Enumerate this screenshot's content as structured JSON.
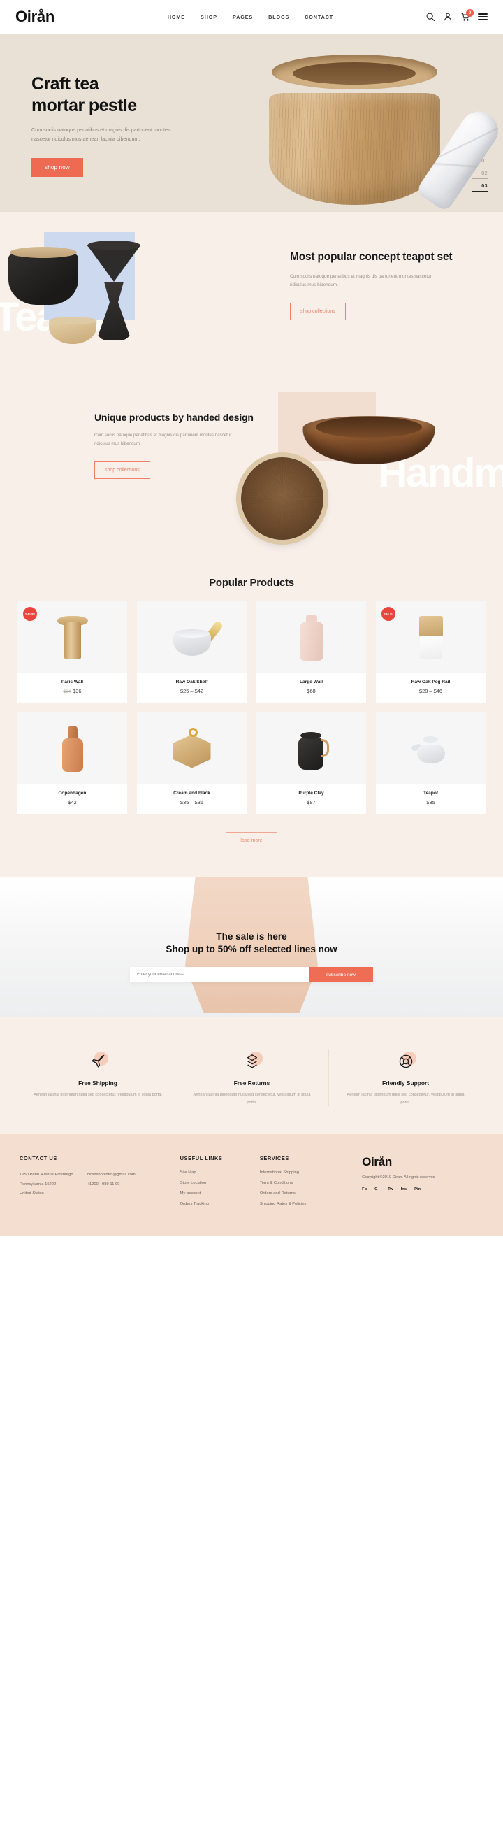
{
  "header": {
    "logo": "Oirån",
    "nav": [
      {
        "label": "HOME"
      },
      {
        "label": "SHOP"
      },
      {
        "label": "PAGES"
      },
      {
        "label": "BLOGS"
      },
      {
        "label": "CONTACT"
      }
    ],
    "icons": {
      "search": "search-icon",
      "account": "user-icon",
      "cart": "cart-icon",
      "menu": "hamburger-icon"
    },
    "cart_count": "0"
  },
  "hero": {
    "title_line1": "Craft tea",
    "title_line2": "mortar pestle",
    "description": "Cum sociis natoque penatibus et magnis dis parturient montes nascetur ridiculus mus aenean lacinia bibendum.",
    "cta": "shop now",
    "slides": [
      {
        "num": "01",
        "active": false
      },
      {
        "num": "02",
        "active": false
      },
      {
        "num": "03",
        "active": true
      }
    ]
  },
  "teapot_section": {
    "watermark": "Teapot",
    "title": "Most popular concept teapot set",
    "description": "Cum sociis natoque penatibus et magnis dis parturient montes nascetur ridiculus mus bibendum.",
    "cta": "shop collections"
  },
  "handmade_section": {
    "watermark": "Handm",
    "title": "Unique products by handed design",
    "description": "Cum sociis natoque penatibus et magnis dis parturient montes nascetur ridiculus mus bibendum.",
    "cta": "shop collections"
  },
  "products_section": {
    "title": "Popular Products",
    "sale_badge": "SALE!",
    "load_more": "load more",
    "items": [
      {
        "name": "Paris Wall",
        "old_price": "$64",
        "price": "$36",
        "sale": true,
        "icon": "vase-icon"
      },
      {
        "name": "Raw Oak Shelf",
        "old_price": "",
        "price": "$25 – $42",
        "sale": false,
        "icon": "mortar-icon"
      },
      {
        "name": "Large Wall",
        "old_price": "",
        "price": "$68",
        "sale": false,
        "icon": "flask-icon"
      },
      {
        "name": "Raw Oak Peg Rail",
        "old_price": "",
        "price": "$28 – $46",
        "sale": true,
        "icon": "peg-rail-icon"
      },
      {
        "name": "Copenhagen",
        "old_price": "",
        "price": "$42",
        "sale": false,
        "icon": "bottle-icon"
      },
      {
        "name": "Cream and black",
        "old_price": "",
        "price": "$35 – $36",
        "sale": false,
        "icon": "hex-box-icon"
      },
      {
        "name": "Purple Clay",
        "old_price": "",
        "price": "$87",
        "sale": false,
        "icon": "kettle-icon"
      },
      {
        "name": "Teapot",
        "old_price": "",
        "price": "$35",
        "sale": false,
        "icon": "teapot-icon"
      }
    ]
  },
  "sale_banner": {
    "line1": "The sale is here",
    "line2": "Shop up to 50% off selected lines now",
    "email_placeholder": "Enter your email address",
    "email_value": "",
    "subscribe": "subscribe now"
  },
  "features": [
    {
      "icon": "plane-icon",
      "title": "Free Shipping",
      "text": "Aenean lacinia bibendum nulla sed consectetur. Vestibulum id ligula porta."
    },
    {
      "icon": "box-icon",
      "title": "Free Returns",
      "text": "Aenean lacinia bibendum nulla sed consectetur. Vestibulum id ligula porta."
    },
    {
      "icon": "lifebuoy-icon",
      "title": "Friendly Support",
      "text": "Aenean lacinia bibendum nulla sed consectetur. Vestibulum id ligula porta."
    }
  ],
  "footer": {
    "contact": {
      "heading": "CONTACT US",
      "address_line1": "1250 Penn Avenue Pittsburgh",
      "address_line2": "Pennsylvania 15222",
      "address_line3": "United States",
      "email": "oiranshopintro@gmail.com",
      "phone": "+1200 - 989 11 90"
    },
    "useful_links": {
      "heading": "USEFUL LINKS",
      "items": [
        "Site Map",
        "Store Location",
        "My account",
        "Orders Tracking"
      ]
    },
    "services": {
      "heading": "SERVICES",
      "items": [
        "International Shipping",
        "Term & Conditions",
        "Orders and Returns",
        "Shipping Rates & Policies"
      ]
    },
    "brand": {
      "logo": "Oirån",
      "copyright": "Copyright ©2019 Oiran. All rights reserved",
      "social": [
        "Fb",
        "G+",
        "Tw",
        "Ins",
        "Pin"
      ]
    }
  },
  "colors": {
    "accent": "#ee6a52",
    "hero_bg": "#e9e1d6",
    "section_bg": "#f7efe8",
    "footer_bg": "#f3ded0",
    "sale_badge": "#e8453c"
  }
}
